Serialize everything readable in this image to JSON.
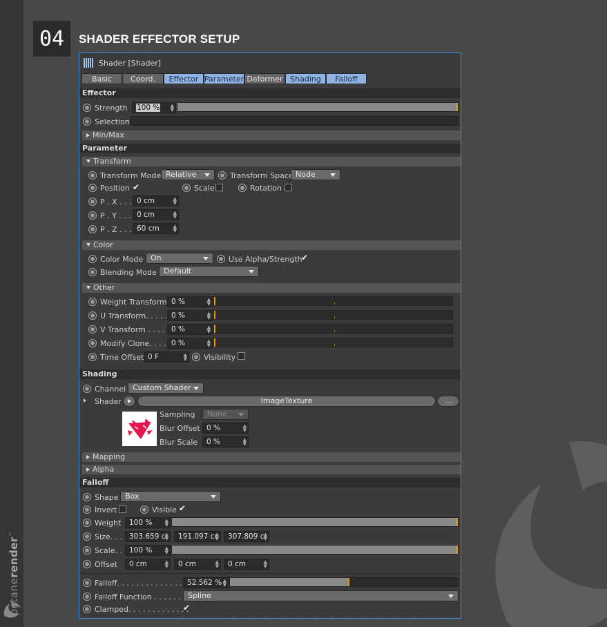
{
  "step": {
    "number": "04",
    "title": "SHADER EFFECTOR SETUP"
  },
  "brand": {
    "prefix": "octane",
    "suffix": "render",
    "tm": "™"
  },
  "window": {
    "title": "Shader [Shader]"
  },
  "tabs": [
    "Basic",
    "Coord.",
    "Effector",
    "Parameter",
    "Deformer",
    "Shading",
    "Falloff"
  ],
  "effector": {
    "section": "Effector",
    "strength_label": "Strength",
    "strength_value": "100 %",
    "strength_fraction": 1.0,
    "selection_label": "Selection",
    "minmax_label": "Min/Max"
  },
  "parameter": {
    "section": "Parameter",
    "transform": {
      "group": "Transform",
      "mode_label": "Transform Mode",
      "mode_value": "Relative",
      "space_label": "Transform Space",
      "space_value": "Node",
      "position_label": "Position",
      "scale_label": "Scale",
      "rotation_label": "Rotation",
      "px_label": "P . X . . . .",
      "px_value": "0 cm",
      "py_label": "P . Y . . . .",
      "py_value": "0 cm",
      "pz_label": "P . Z . . . .",
      "pz_value": "60 cm"
    },
    "color": {
      "group": "Color",
      "mode_label": "Color Mode",
      "mode_value": "On",
      "use_alpha_label": "Use Alpha/Strength",
      "blending_label": "Blending Mode",
      "blending_value": "Default"
    },
    "other": {
      "group": "Other",
      "weight_label": "Weight Transform",
      "weight_value": "0 %",
      "u_label": "U Transform. . . . .",
      "u_value": "0 %",
      "v_label": "V Transform . . . . .",
      "v_value": "0 %",
      "modify_label": "Modify Clone. . . .",
      "modify_value": "0 %",
      "time_label": "Time Offset",
      "time_value": "0 F",
      "visibility_label": "Visibility"
    }
  },
  "shading": {
    "section": "Shading",
    "channel_label": "Channel",
    "channel_value": "Custom Shader",
    "shader_label": "Shader",
    "shader_value": "ImageTexture",
    "more_label": "...",
    "sampling_label": "Sampling",
    "sampling_value": "None",
    "blur_offset_label": "Blur Offset",
    "blur_offset_value": "0 %",
    "blur_scale_label": "Blur Scale",
    "blur_scale_value": "0 %",
    "mapping_label": "Mapping",
    "alpha_label": "Alpha"
  },
  "falloff": {
    "section": "Falloff",
    "shape_label": "Shape",
    "shape_value": "Box",
    "invert_label": "Invert",
    "visible_label": "Visible",
    "weight_label": "Weight",
    "weight_value": "100 %",
    "weight_fraction": 1.0,
    "size_label": "Size. . .",
    "size_x": "303.659 cı",
    "size_y": "191.097 cı",
    "size_z": "307.809 cı",
    "scale_label": "Scale. . .",
    "scale_value": "100 %",
    "scale_fraction": 1.0,
    "offset_label": "Offset",
    "offset_x": "0 cm",
    "offset_y": "0 cm",
    "offset_z": "0 cm",
    "falloff_label": "Falloff. . . . . . . . . . . . . .",
    "falloff_value": "52.562 %",
    "falloff_fraction": 0.52562,
    "function_label": "Falloff Function . . . . . . .",
    "function_value": "Spline",
    "clamped_label": "Clamped. . . . . . . . . . . . ."
  },
  "colors": {
    "accent": "#3f8ed8",
    "tab_active": "#8fb3e3",
    "slider_marker": "#e0a000"
  }
}
